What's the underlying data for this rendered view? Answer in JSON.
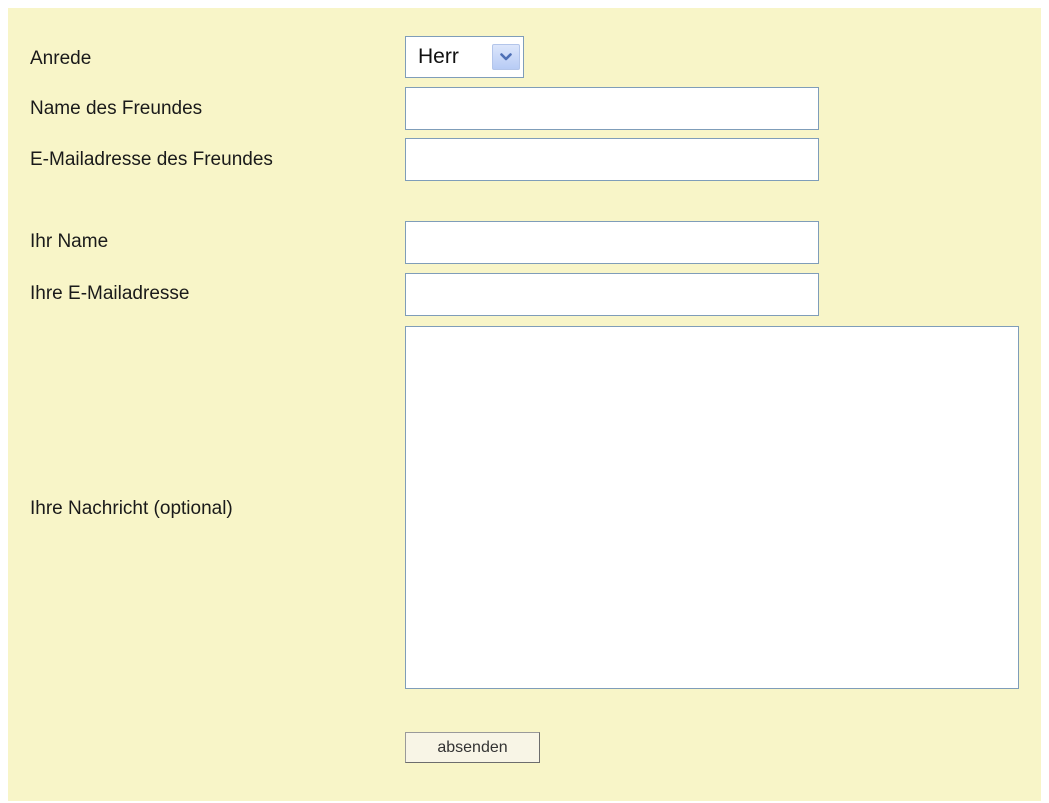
{
  "form": {
    "salutation": {
      "label": "Anrede",
      "selected": "Herr",
      "icon": "chevron-down-icon"
    },
    "friend_name": {
      "label": "Name des Freundes",
      "value": ""
    },
    "friend_email": {
      "label": "E-Mailadresse des Freundes",
      "value": ""
    },
    "your_name": {
      "label": "Ihr Name",
      "value": ""
    },
    "your_email": {
      "label": "Ihre E-Mailadresse",
      "value": ""
    },
    "message": {
      "label": "Ihre Nachricht (optional)",
      "value": ""
    },
    "submit_label": "absenden"
  },
  "colors": {
    "panel_background": "#f8f5c8",
    "field_border": "#7f9db9",
    "dropdown_arrow_accent": "#4d6fb5"
  }
}
